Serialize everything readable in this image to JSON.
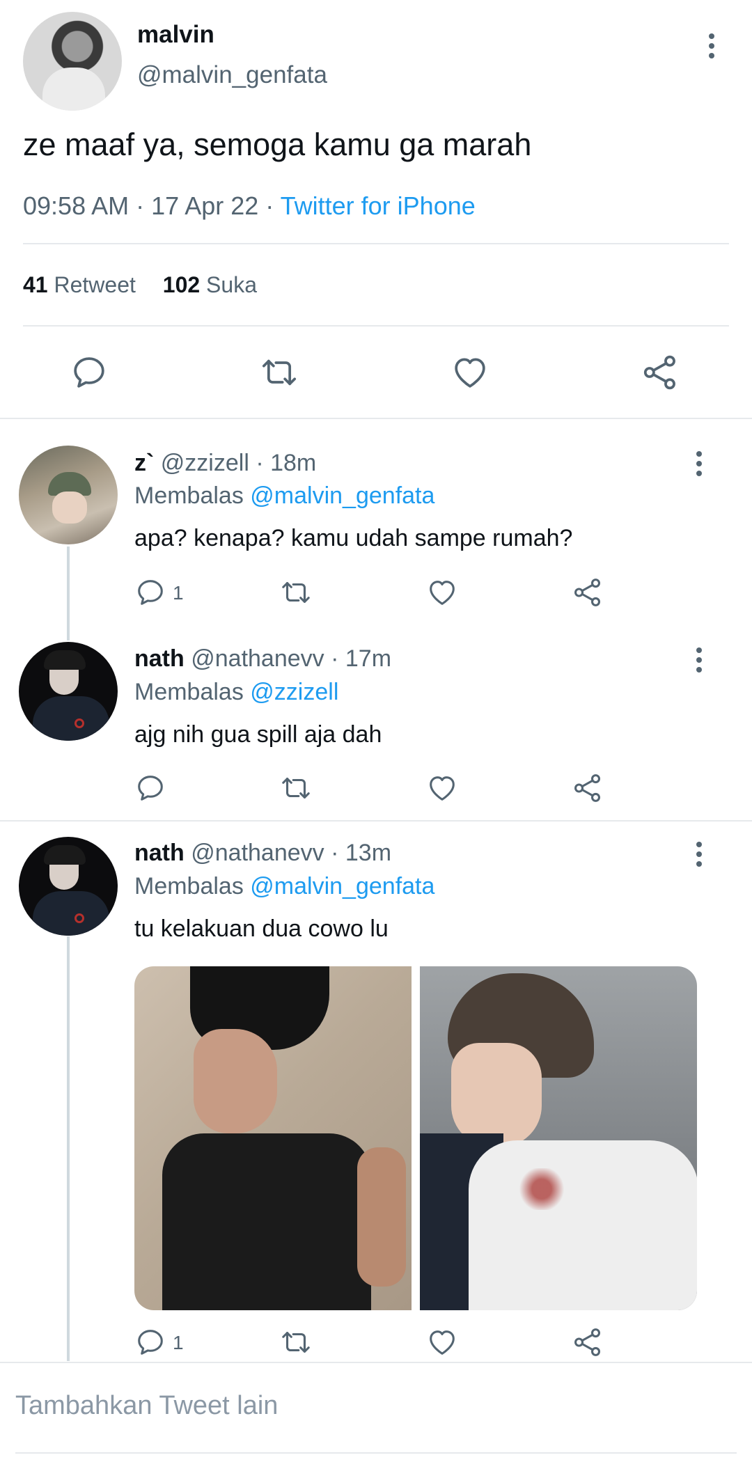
{
  "main_tweet": {
    "display_name": "malvin",
    "handle": "@malvin_genfata",
    "text": "ze maaf ya, semoga kamu ga marah",
    "time": "09:58 AM",
    "date": "17 Apr 22",
    "sep1": "·",
    "sep2": "·",
    "source": "Twitter for iPhone",
    "retweet_count": "41",
    "retweet_label": "Retweet",
    "like_count": "102",
    "like_label": "Suka"
  },
  "replies": [
    {
      "display_name": "z`",
      "handle": "@zzizell",
      "time": "· 18m",
      "replying_prefix": "Membalas",
      "replying_to": "@malvin_genfata",
      "text": "apa? kenapa? kamu udah sampe rumah?",
      "reply_count": "1"
    },
    {
      "display_name": "nath",
      "handle": "@nathanevv",
      "time": "· 17m",
      "replying_prefix": "Membalas",
      "replying_to": "@zzizell",
      "text": "ajg nih gua spill aja dah"
    },
    {
      "display_name": "nath",
      "handle": "@nathanevv",
      "time": "· 13m",
      "replying_prefix": "Membalas",
      "replying_to": "@malvin_genfata",
      "text": "tu kelakuan dua cowo lu",
      "reply_count": "1"
    }
  ],
  "composer": {
    "placeholder": "Tambahkan Tweet lain"
  },
  "colors": {
    "link": "#1d9bf0",
    "secondary_text": "#536471",
    "divider": "#e6e9ec"
  },
  "icons": [
    "reply-icon",
    "retweet-icon",
    "like-icon",
    "share-icon",
    "more-icon"
  ]
}
